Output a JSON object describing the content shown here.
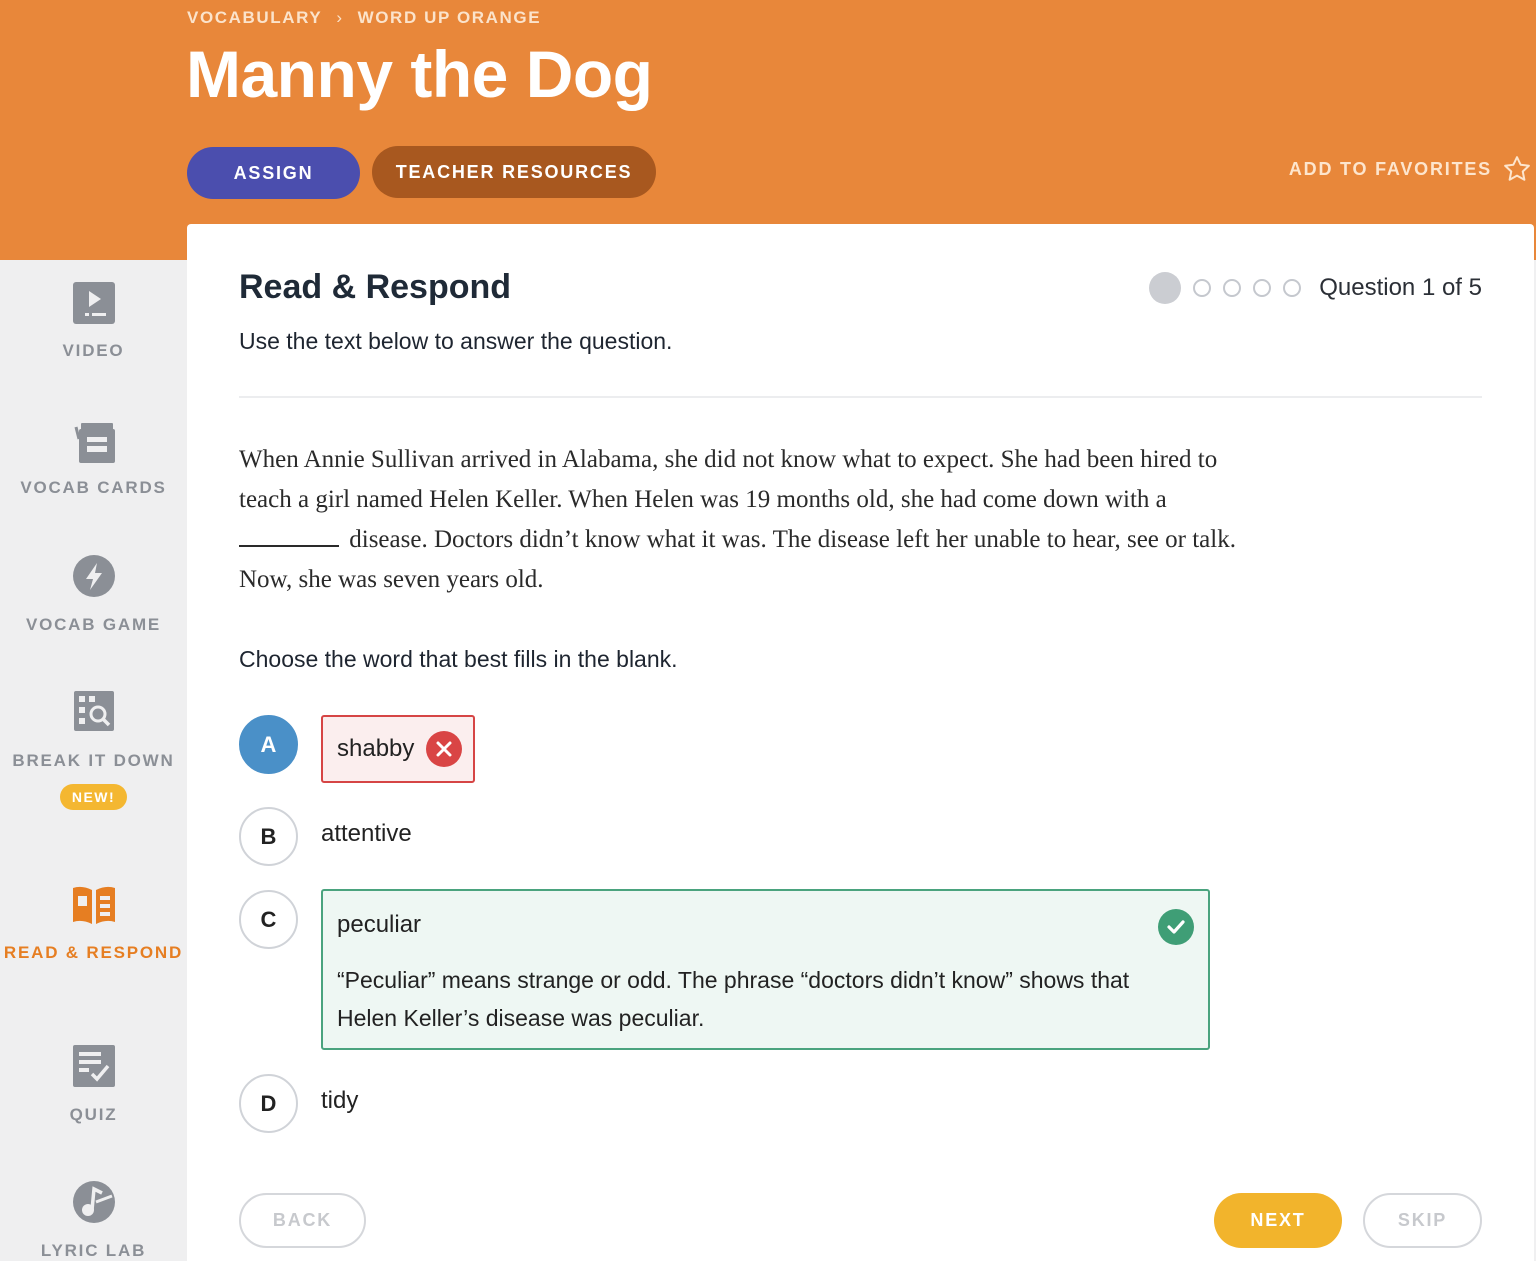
{
  "header": {
    "breadcrumb": [
      "VOCABULARY",
      "WORD UP ORANGE"
    ],
    "breadcrumb_separator": "›",
    "title": "Manny the Dog",
    "assign_label": "ASSIGN",
    "resources_label": "TEACHER RESOURCES",
    "favorites_label": "ADD TO FAVORITES",
    "colors": {
      "background": "#e8873a",
      "assign": "#4b4eae",
      "resources": "#a8581f"
    }
  },
  "sidebar": {
    "items": [
      {
        "label": "VIDEO",
        "icon": "video-icon"
      },
      {
        "label": "VOCAB CARDS",
        "icon": "vocab-cards-icon"
      },
      {
        "label": "VOCAB GAME",
        "icon": "lightning-icon"
      },
      {
        "label": "BREAK IT DOWN",
        "icon": "magnifier-grid-icon",
        "badge": "NEW!"
      },
      {
        "label": "READ & RESPOND",
        "icon": "open-book-icon",
        "active": true
      },
      {
        "label": "QUIZ",
        "icon": "checklist-icon"
      },
      {
        "label": "LYRIC LAB",
        "icon": "music-note-icon"
      }
    ],
    "active_color": "#e67e22"
  },
  "main": {
    "title": "Read & Respond",
    "progress": {
      "current": 1,
      "total": 5,
      "label": "Question 1 of 5"
    },
    "instructions": "Use the text below to answer the question.",
    "passage_before_blank": "When Annie Sullivan arrived in Alabama, she did not know what to expect. She had been hired to teach a girl named Helen Keller. When Helen was 19 months old, she had come down with a",
    "passage_after_blank": "disease. Doctors didn’t know what it was. The disease left her unable to hear, see or talk. Now, she was seven years old.",
    "prompt": "Choose the word that best fills in the blank.",
    "options": [
      {
        "letter": "A",
        "text": "shabby",
        "state": "incorrect",
        "selected": true
      },
      {
        "letter": "B",
        "text": "attentive"
      },
      {
        "letter": "C",
        "text": "peculiar",
        "state": "correct",
        "explanation": "“Peculiar” means strange or odd. The phrase “doctors didn’t know” shows that Helen Keller’s disease was peculiar."
      },
      {
        "letter": "D",
        "text": "tidy"
      }
    ],
    "buttons": {
      "back": "BACK",
      "next": "NEXT",
      "skip": "SKIP"
    },
    "colors": {
      "incorrect": "#d64545",
      "correct": "#4aa37e",
      "selected": "#4a90c8",
      "next": "#f2b42c"
    }
  }
}
